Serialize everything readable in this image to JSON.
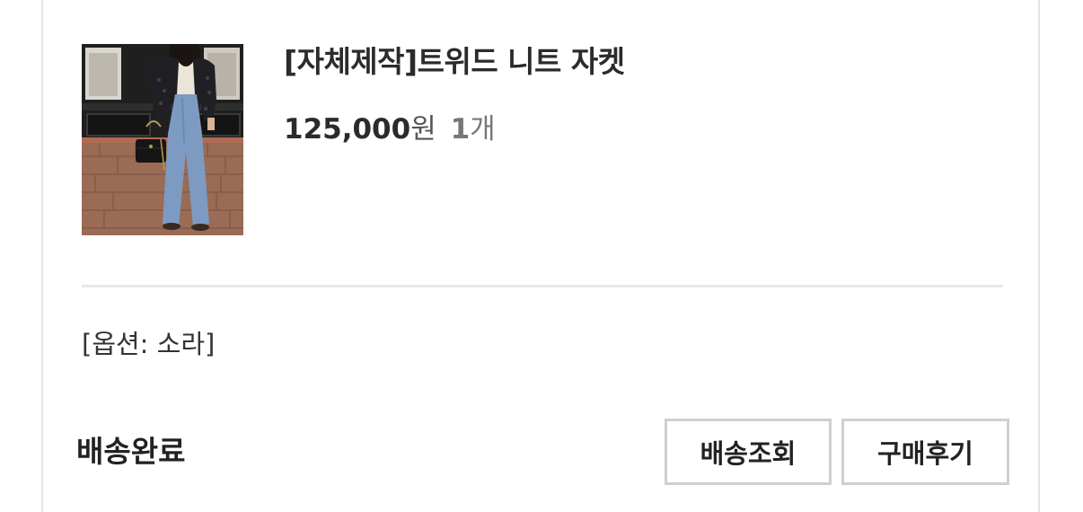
{
  "order_item": {
    "product_name": "[자체제작]트위드 니트 자켓",
    "price": "125,000",
    "price_unit": "원",
    "quantity": "1",
    "quantity_unit": "개",
    "option_text": "[옵션: 소라]",
    "status": "배송완료",
    "thumbnail_icon": "product-photo"
  },
  "actions": {
    "track_label": "배송조회",
    "review_label": "구매후기"
  },
  "colors": {
    "border": "#e4e4e4",
    "button_border": "#cfcfcf",
    "text": "#222222"
  }
}
